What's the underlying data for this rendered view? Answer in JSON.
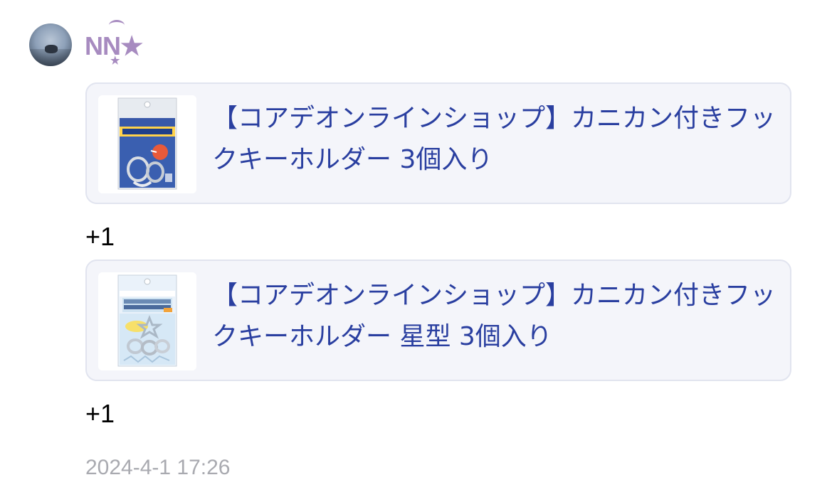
{
  "user": {
    "avatar_icon": "user-avatar",
    "name": "NN★",
    "name_color": "#a78bc0",
    "name_mark": "★"
  },
  "items": [
    {
      "title": "【コアデオンラインショップ】カニカン付きフックキーホルダー 3個入り",
      "count": "+1",
      "thumbnail_icon": "keyholder-package-icon"
    },
    {
      "title": "【コアデオンラインショップ】カニカン付きフックキーホルダー 星型 3個入り",
      "count": "+1",
      "thumbnail_icon": "star-keyholder-package-icon"
    }
  ],
  "timestamp": "2024-4-1 17:26",
  "colors": {
    "link": "#2a3fa0",
    "card_bg": "#f4f5fa",
    "card_border": "#e1e4ef",
    "timestamp": "#a9aab0"
  }
}
